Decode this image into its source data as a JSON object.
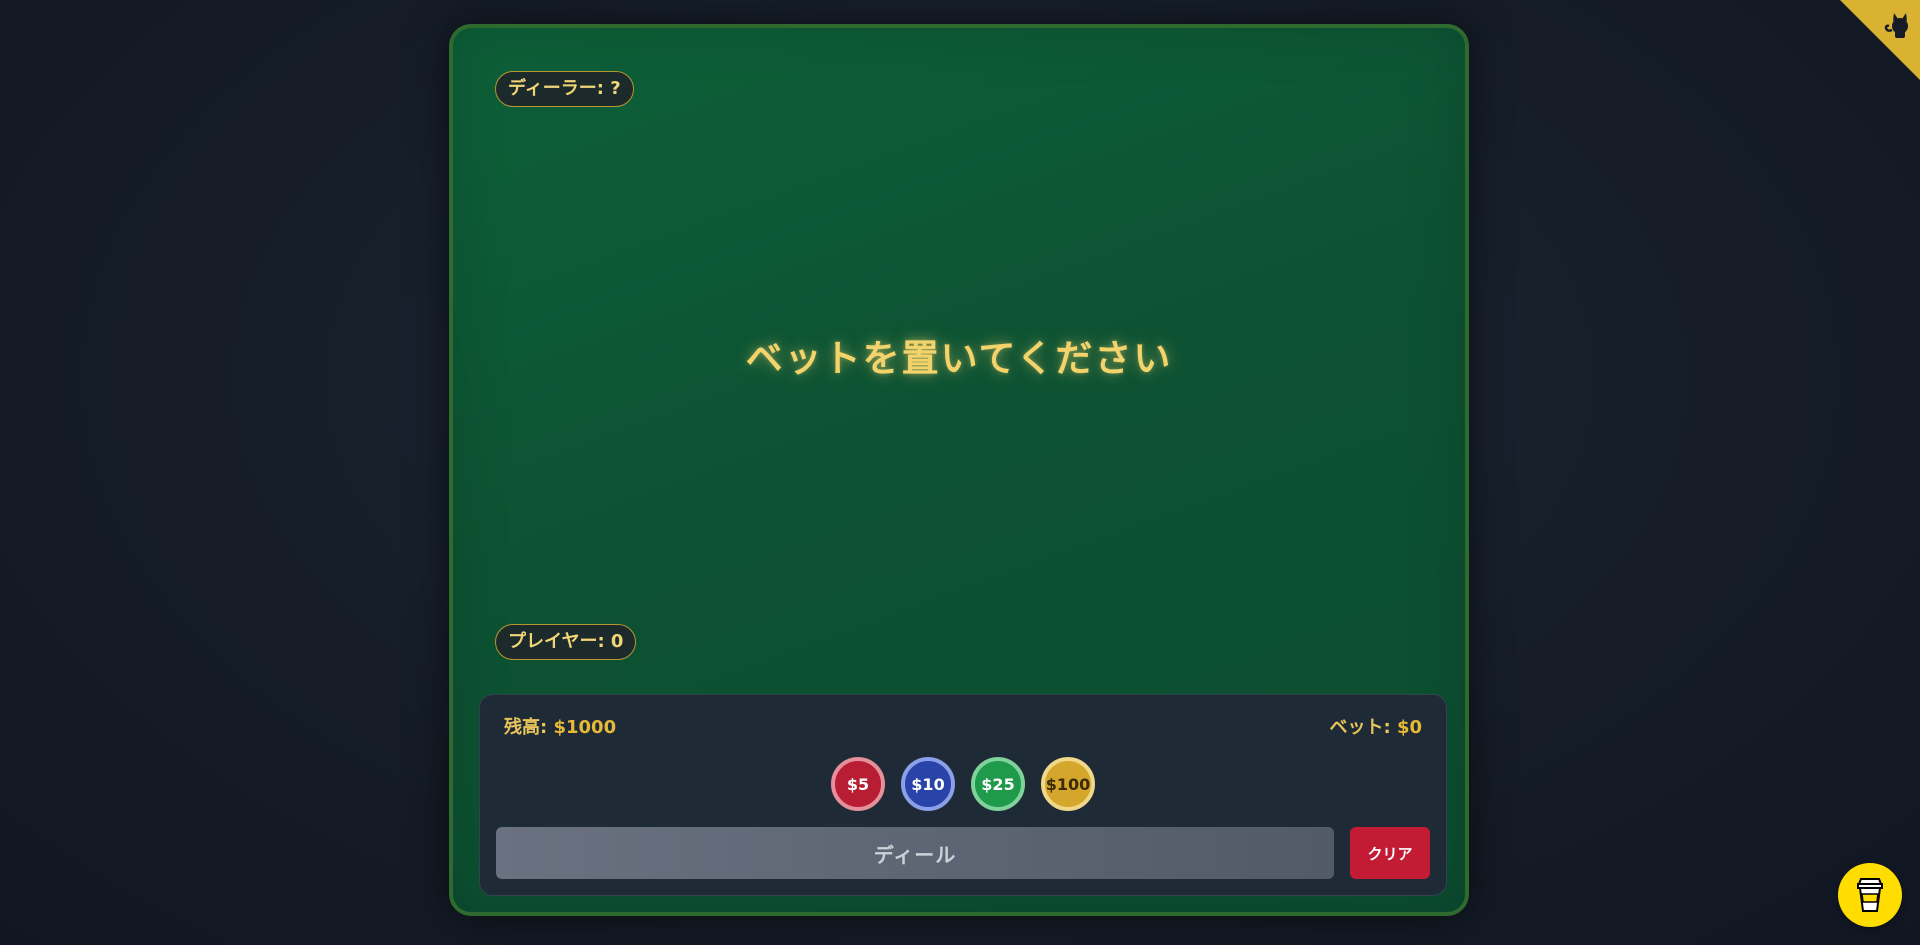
{
  "dealer": {
    "label": "ディーラー: ?"
  },
  "player": {
    "label": "プレイヤー: 0"
  },
  "message": "ベットを置いてください",
  "panel": {
    "balance_label": "残高:",
    "balance_value": "$1000",
    "bet_label": "ベット:",
    "bet_value": "$0",
    "chips": [
      {
        "label": "$5",
        "color": "#b81d34"
      },
      {
        "label": "$10",
        "color": "#2a43a8"
      },
      {
        "label": "$25",
        "color": "#1f9a4a"
      },
      {
        "label": "$100",
        "color": "#d4a72c"
      }
    ],
    "deal_label": "ディール",
    "clear_label": "クリア"
  },
  "icons": {
    "corner": "github-corner-icon",
    "coffee": "coffee-cup-icon"
  },
  "colors": {
    "felt": "#0d5233",
    "accent_gold": "#f3d36b",
    "clear_red": "#c41b35",
    "coffee_yellow": "#ffdd00"
  }
}
